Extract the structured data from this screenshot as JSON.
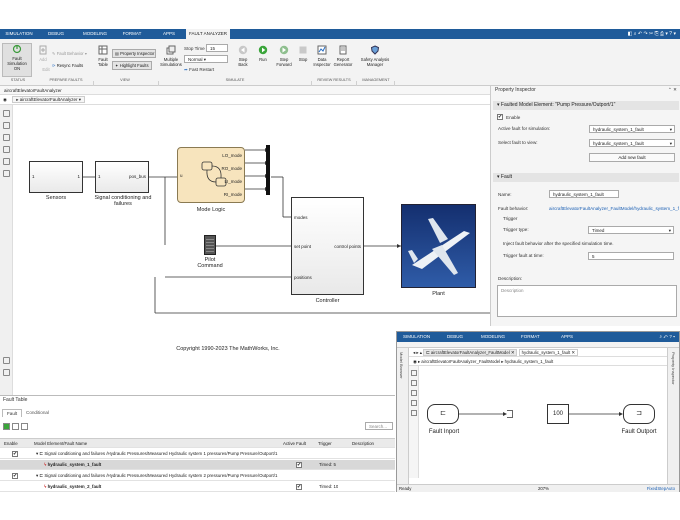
{
  "tabs": [
    "SIMULATION",
    "DEBUG",
    "MODELING",
    "FORMAT",
    "APPS",
    "FAULT ANALYZER"
  ],
  "ribbon": {
    "fault_sim_label": "Fault Simulation",
    "fault_sim_state": "ON",
    "add_label": "Add",
    "edit_label": "Edit",
    "fault_behavior_label": "Fault Behavior",
    "resync_label": "Resync Faults",
    "fault_table_label": "Fault Table",
    "property_inspector_label": "Property Inspector",
    "highlight_label": "Highlight Faults",
    "multiple_sims_label": "Multiple Simulations",
    "stop_time_label": "Stop Time",
    "stop_time_value": "15",
    "sim_mode_value": "Normal",
    "fast_restart_label": "Fast Restart",
    "step_back_label": "Step Back",
    "run_label": "Run",
    "step_fwd_label": "Step Forward",
    "stop_label": "Stop",
    "data_inspector_label": "Data Inspector",
    "report_gen_label": "Report Generator",
    "safety_label": "Safety Analysis Manager",
    "groups": [
      "STATUS",
      "PREPARE FAULTS",
      "VIEW",
      "SIMULATE",
      "REVIEW RESULTS",
      "MANAGEMENT"
    ]
  },
  "model": {
    "address": "aircraftElevatorFaultAnalyzer",
    "breadcrumb": "aircraftElevatorFaultAnalyzer",
    "blocks": {
      "sensors": "Sensors",
      "signal": "Signal conditioning and failures",
      "signal_port": "pos_bus",
      "mode_logic": "Mode Logic",
      "modes": [
        "LO_mode",
        "RO_mode",
        "LI_mode",
        "RI_mode"
      ],
      "pilot": "Pilot Command",
      "controller": "Controller",
      "ctrl_ports": [
        "modes",
        "set point",
        "positions"
      ],
      "ctrl_out": "control points",
      "plant": "Plant",
      "in_port": "1",
      "out_port": "1"
    },
    "copyright": "Copyright 1990-2023 The MathWorks, Inc."
  },
  "inspector": {
    "title": "Property Inspector",
    "section1": "Faulted Model Element: \"Pump Pressure/Outport/1\"",
    "enable_label": "Enable",
    "active_fault_label": "Active fault for simulation:",
    "active_fault_value": "hydraulic_system_1_fault",
    "select_fault_label": "Select fault to view:",
    "select_fault_value": "hydraulic_system_1_fault",
    "add_fault_label": "Add new fault",
    "section2": "Fault",
    "name_label": "Name:",
    "name_value": "hydraulic_system_1_fault",
    "behavior_label": "Fault behavior:",
    "behavior_value": "aircraftElevatorFaultAnalyzer_FaultModel/hydraulic_system_1_fault",
    "trigger_label": "Trigger",
    "trigger_type_label": "Trigger type:",
    "trigger_type_value": "Timed",
    "trigger_desc": "Inject fault behavior after the specified simulation time.",
    "trigger_time_label": "Trigger fault at time:",
    "trigger_time_value": "5",
    "desc_label": "Description:",
    "desc_placeholder": "Description"
  },
  "fault_table": {
    "title": "Fault Table",
    "tabs": [
      "Fault",
      "Conditional"
    ],
    "search_placeholder": "Search...",
    "headers": [
      "Enable",
      "Model Element/Fault Name",
      "Active Fault",
      "Trigger",
      "Description"
    ],
    "rows": [
      {
        "name": "Signal conditioning and failures /Hydraulic Pressures/Measured Hydraulic system 1 pressures/Pump Pressure/Outport/1",
        "trigger": ""
      },
      {
        "name": "hydraulic_system_1_fault",
        "trigger": "Timed: 5"
      },
      {
        "name": "Signal conditioning and failures /Hydraulic Pressures/Measured Hydraulic system 2 pressures/Pump Pressure/Outport/1",
        "trigger": ""
      },
      {
        "name": "hydraulic_system_2_fault",
        "trigger": "Timed: 10"
      }
    ]
  },
  "fault_model": {
    "tabs": [
      "SIMULATION",
      "DEBUG",
      "MODELING",
      "FORMAT",
      "APPS"
    ],
    "tab_title": "hydraulic_system_1_fault",
    "address": "aircraftElevatorFaultAnalyzer_FaultModel",
    "breadcrumb": "hydraulic_system_1_fault",
    "side_left": "Model Browser",
    "side_right": "Property Inspector",
    "fault_inport": "Fault Inport",
    "fault_outport": "Fault Outport",
    "constant": "100",
    "status_ready": "Ready",
    "status_zoom": "207%",
    "status_solver": "FixedStepAuto"
  },
  "colors": {
    "tabbar": "#1f5b9a",
    "link": "#1a5fb4",
    "mode_logic": "#f7e4bd",
    "plant_sky": "#1b3f8f"
  }
}
